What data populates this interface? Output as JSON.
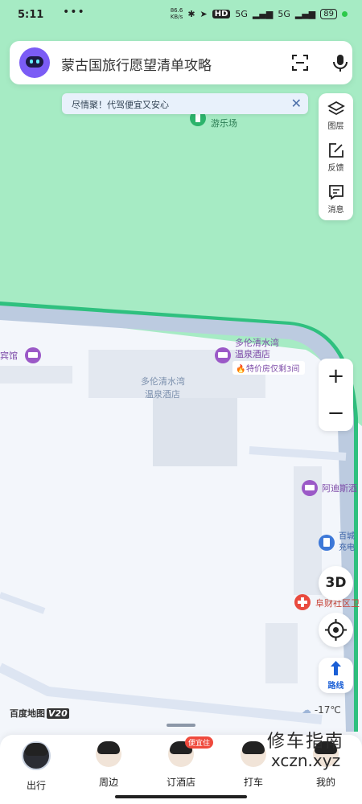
{
  "status_bar": {
    "time": "5:11",
    "dots": "•••",
    "net_speed_value": "86.6",
    "net_speed_unit": "KB/s",
    "hd": "HD",
    "signal1": "5G",
    "signal2": "5G",
    "battery": "89"
  },
  "search": {
    "text": "蒙古国旅行愿望清单攻略"
  },
  "notice": {
    "text": "尽情聚！代驾便宜又安心",
    "close": "✕"
  },
  "right_panel": {
    "layers_label": "图层",
    "feedback_label": "反馈",
    "messages_label": "消息"
  },
  "map_labels": {
    "park_name": "游乐场",
    "hotel_left": "宾馆",
    "hotel_main_line1": "多伦清水湾",
    "hotel_main_line2": "温泉酒店",
    "promo": "特价房仅剩3间",
    "building_line1": "多伦清水湾",
    "building_line2": "温泉酒店",
    "hotel_right": "阿迪斯酒",
    "charge_line1": "百城",
    "charge_line2": "充电",
    "clinic": "阜财社区卫"
  },
  "controls": {
    "zoom_in": "+",
    "zoom_out": "−",
    "three_d": "3D",
    "route_label": "路线"
  },
  "map_footer": {
    "logo": "百度地图",
    "version": "V20",
    "temperature": "-17℃"
  },
  "bottom_nav": [
    {
      "label": "出行"
    },
    {
      "label": "周边"
    },
    {
      "label": "订酒店",
      "badge": "便宜住"
    },
    {
      "label": "打车"
    },
    {
      "label": "我的"
    }
  ],
  "watermark": {
    "line1": "修车指南",
    "line2": "xczn.xyz"
  },
  "colors": {
    "park_green": "#a6ebc4",
    "road_blue": "#bccbe0",
    "road_edge": "#2fc07f",
    "hotel_pin": "#9b59c7",
    "clinic_pin": "#e94a3e",
    "charge_pin": "#3d78d8",
    "route_blue": "#1a5fd6"
  }
}
